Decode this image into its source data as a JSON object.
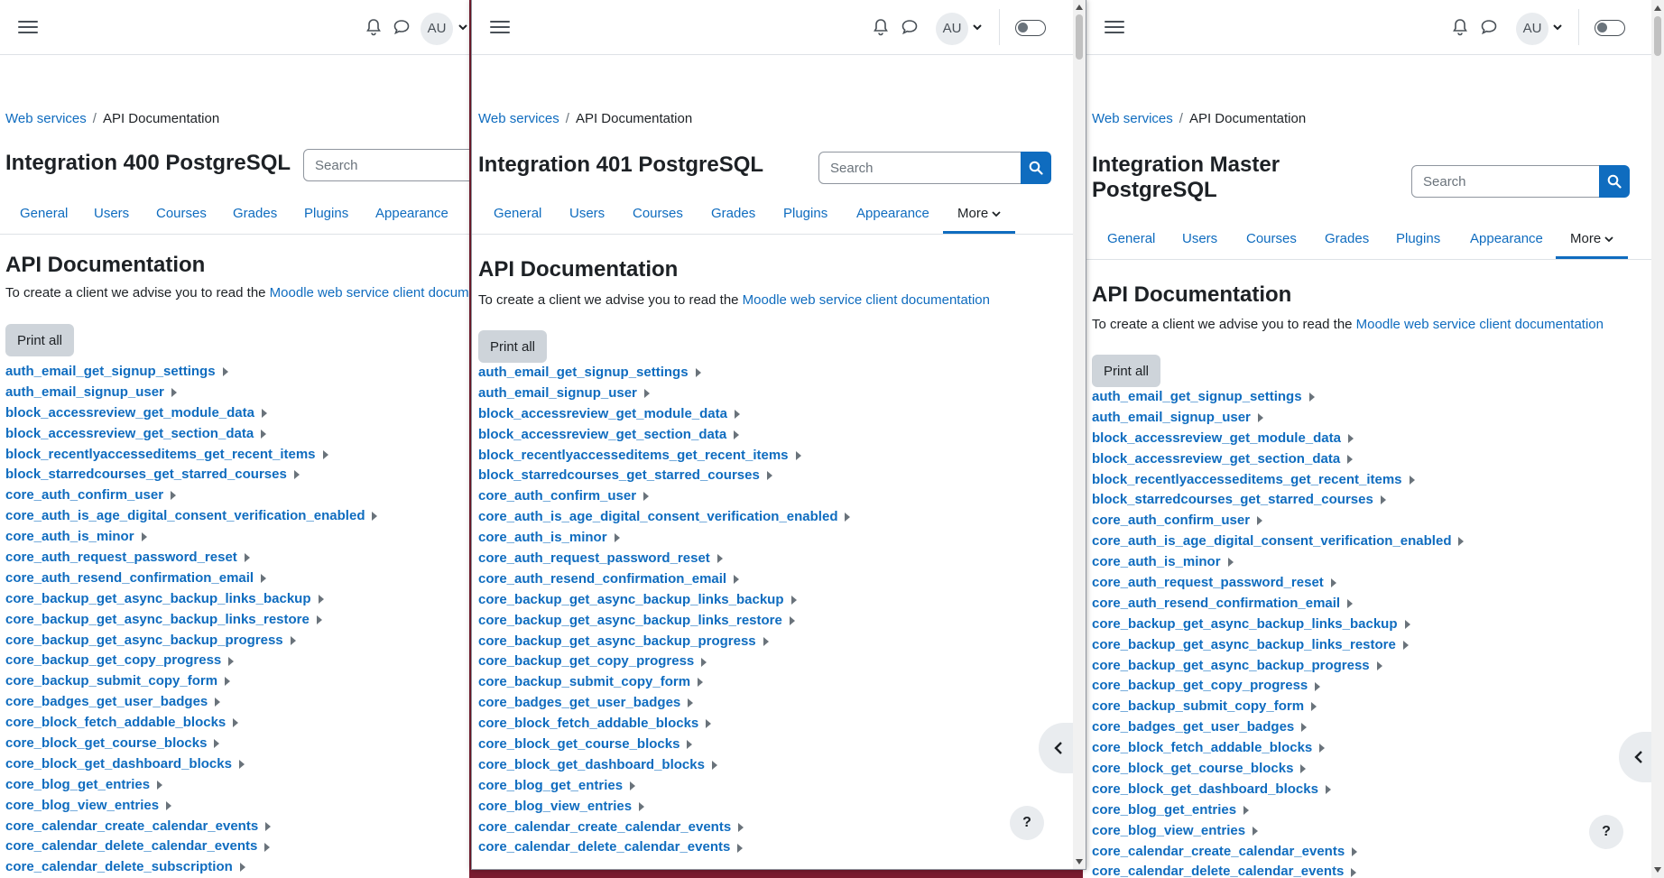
{
  "header": {
    "avatar_initials": "AU"
  },
  "breadcrumb": {
    "parent": "Web services",
    "separator": "/",
    "current": "API Documentation"
  },
  "search": {
    "placeholder": "Search"
  },
  "windows": [
    {
      "site_title": "Integration 400 PostgreSQL"
    },
    {
      "site_title": "Integration 401 PostgreSQL"
    },
    {
      "site_title_line1": "Integration Master",
      "site_title_line2": "PostgreSQL"
    }
  ],
  "tabs": [
    "General",
    "Users",
    "Courses",
    "Grades",
    "Plugins",
    "Appearance",
    "More"
  ],
  "heading": "API Documentation",
  "intro": {
    "text": "To create a client we advise you to read the ",
    "link": "Moodle web service client documentation",
    "link_truncated": "Moodle web service client documen"
  },
  "print_all": "Print all",
  "help_label": "?",
  "functions": [
    "auth_email_get_signup_settings",
    "auth_email_signup_user",
    "block_accessreview_get_module_data",
    "block_accessreview_get_section_data",
    "block_recentlyaccesseditems_get_recent_items",
    "block_starredcourses_get_starred_courses",
    "core_auth_confirm_user",
    "core_auth_is_age_digital_consent_verification_enabled",
    "core_auth_is_minor",
    "core_auth_request_password_reset",
    "core_auth_resend_confirmation_email",
    "core_backup_get_async_backup_links_backup",
    "core_backup_get_async_backup_links_restore",
    "core_backup_get_async_backup_progress",
    "core_backup_get_copy_progress",
    "core_backup_submit_copy_form",
    "core_badges_get_user_badges",
    "core_block_fetch_addable_blocks",
    "core_block_get_course_blocks",
    "core_block_get_dashboard_blocks",
    "core_blog_get_entries",
    "core_blog_view_entries",
    "core_calendar_create_calendar_events",
    "core_calendar_delete_calendar_events",
    "core_calendar_delete_subscription"
  ]
}
